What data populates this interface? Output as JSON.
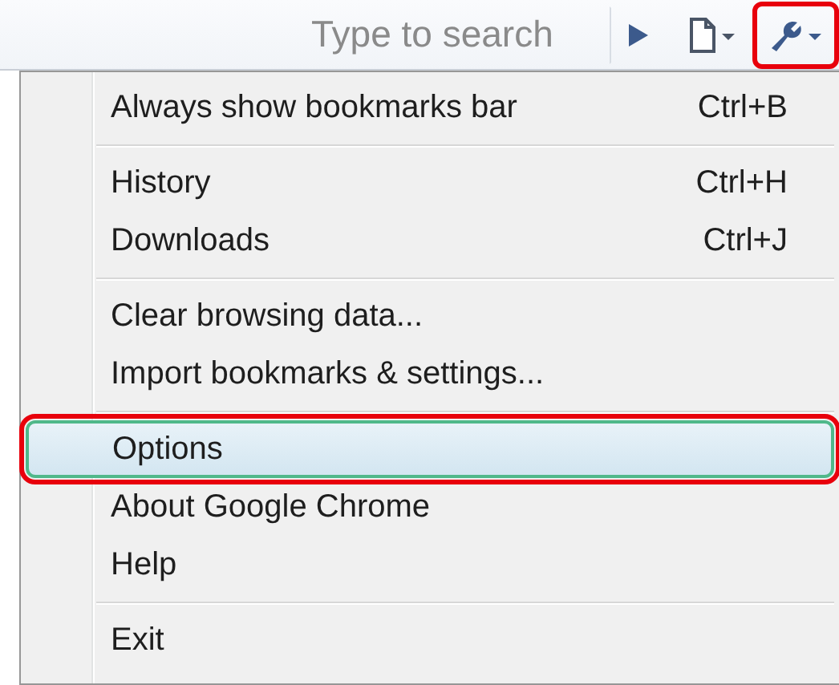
{
  "toolbar": {
    "search": {
      "placeholder": "Type to search"
    },
    "buttons": [
      {
        "kind": "go",
        "annotated": false
      },
      {
        "kind": "page",
        "annotated": false
      },
      {
        "kind": "wrench",
        "annotated": true
      }
    ]
  },
  "menu": {
    "items": [
      {
        "kind": "item",
        "label": "Always show bookmarks bar",
        "shortcut": "Ctrl+B",
        "selected": false,
        "annotated": false
      },
      {
        "kind": "separator"
      },
      {
        "kind": "item",
        "label": "History",
        "shortcut": "Ctrl+H",
        "selected": false,
        "annotated": false
      },
      {
        "kind": "item",
        "label": "Downloads",
        "shortcut": "Ctrl+J",
        "selected": false,
        "annotated": false
      },
      {
        "kind": "separator"
      },
      {
        "kind": "item",
        "label": "Clear browsing data...",
        "selected": false,
        "annotated": false
      },
      {
        "kind": "item",
        "label": "Import bookmarks & settings...",
        "selected": false,
        "annotated": false
      },
      {
        "kind": "separator"
      },
      {
        "kind": "item",
        "label": "Options",
        "selected": true,
        "annotated": true
      },
      {
        "kind": "item",
        "label": "About Google Chrome",
        "selected": false,
        "annotated": false
      },
      {
        "kind": "item",
        "label": "Help",
        "selected": false,
        "annotated": false
      },
      {
        "kind": "separator"
      },
      {
        "kind": "item",
        "label": "Exit",
        "selected": false,
        "annotated": false
      }
    ]
  }
}
